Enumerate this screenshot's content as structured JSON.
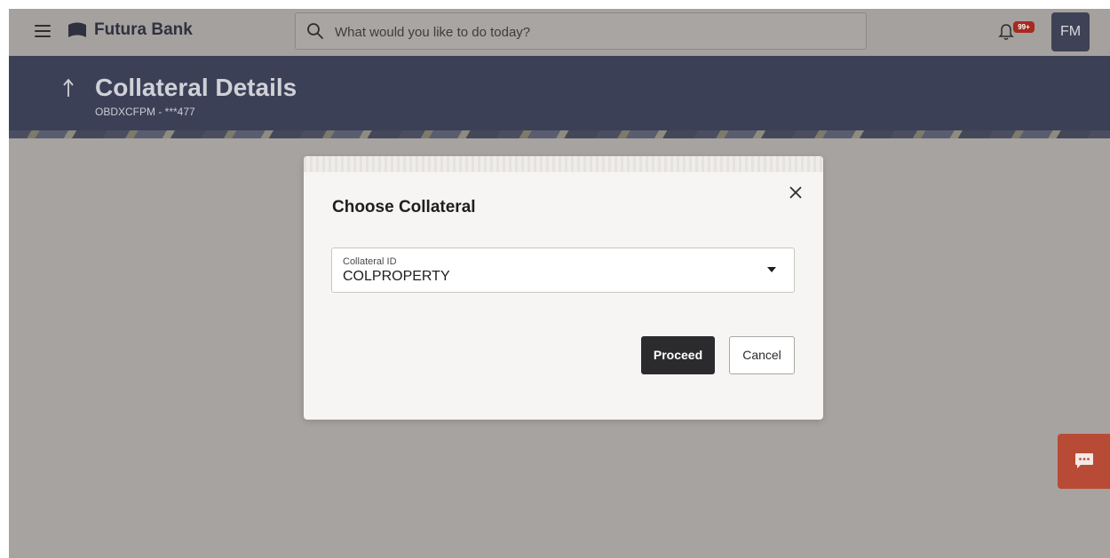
{
  "brand": {
    "name": "Futura Bank",
    "logo_icon": "futura-bank-logo",
    "accent": "#2f3140"
  },
  "search": {
    "placeholder": "What would you like to do today?",
    "value": ""
  },
  "notifications": {
    "badge": "99+",
    "badge_color": "#a52a1f"
  },
  "user": {
    "initials": "FM"
  },
  "header": {
    "title": "Collateral Details",
    "subtitle": "OBDXCFPM - ***477",
    "background": "#3c4057"
  },
  "modal": {
    "title": "Choose Collateral",
    "field": {
      "label": "Collateral ID",
      "value": "COLPROPERTY"
    },
    "proceed_label": "Proceed",
    "cancel_label": "Cancel"
  },
  "chat": {
    "icon": "chat-icon",
    "color": "#b84b36"
  }
}
